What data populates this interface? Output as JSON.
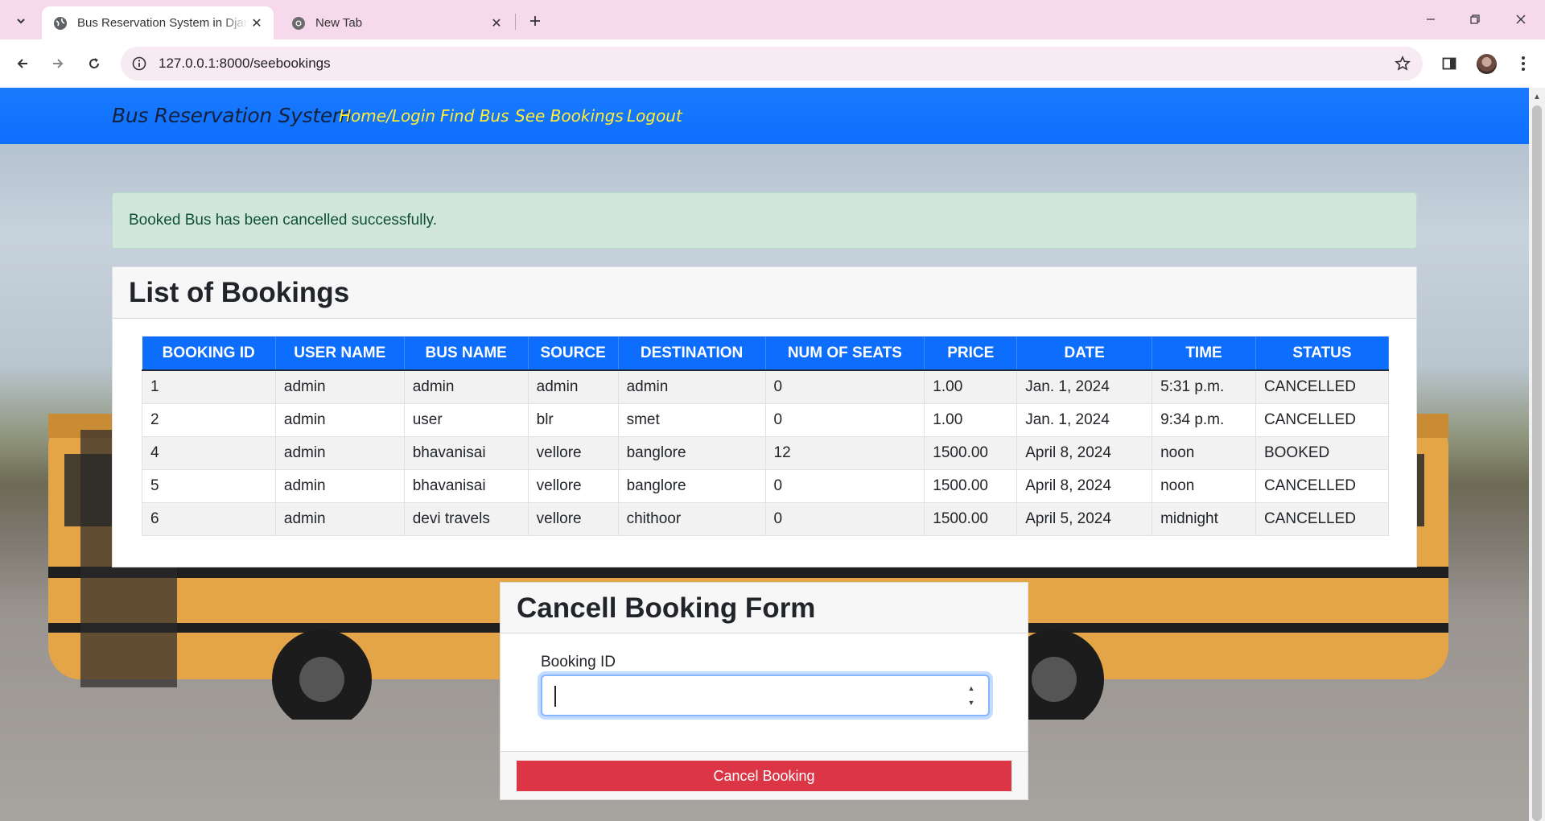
{
  "browser": {
    "tabs": [
      {
        "title": "Bus Reservation System in Djan",
        "active": true
      },
      {
        "title": "New Tab",
        "active": false
      }
    ],
    "url": "127.0.0.1:8000/seebookings"
  },
  "navbar": {
    "brand": "Bus Reservation System",
    "links": [
      "Home/Login",
      "Find Bus",
      "See Bookings",
      "Logout"
    ],
    "link_color": "#ffee33",
    "background": "#0d6efd"
  },
  "alert": {
    "message": "Booked Bus has been cancelled successfully."
  },
  "bookings": {
    "title": "List of Bookings",
    "columns": [
      "BOOKING ID",
      "USER NAME",
      "BUS NAME",
      "SOURCE",
      "DESTINATION",
      "NUM OF SEATS",
      "PRICE",
      "DATE",
      "TIME",
      "STATUS"
    ],
    "rows": [
      [
        "1",
        "admin",
        "admin",
        "admin",
        "admin",
        "0",
        "1.00",
        "Jan. 1, 2024",
        "5:31 p.m.",
        "CANCELLED"
      ],
      [
        "2",
        "admin",
        "user",
        "blr",
        "smet",
        "0",
        "1.00",
        "Jan. 1, 2024",
        "9:34 p.m.",
        "CANCELLED"
      ],
      [
        "4",
        "admin",
        "bhavanisai",
        "vellore",
        "banglore",
        "12",
        "1500.00",
        "April 8, 2024",
        "noon",
        "BOOKED"
      ],
      [
        "5",
        "admin",
        "bhavanisai",
        "vellore",
        "banglore",
        "0",
        "1500.00",
        "April 8, 2024",
        "noon",
        "CANCELLED"
      ],
      [
        "6",
        "admin",
        "devi travels",
        "vellore",
        "chithoor",
        "0",
        "1500.00",
        "April 5, 2024",
        "midnight",
        "CANCELLED"
      ]
    ]
  },
  "cancel_form": {
    "title": "Cancell Booking Form",
    "label": "Booking ID",
    "value": "",
    "button": "Cancel Booking",
    "button_color": "#dc3545"
  }
}
